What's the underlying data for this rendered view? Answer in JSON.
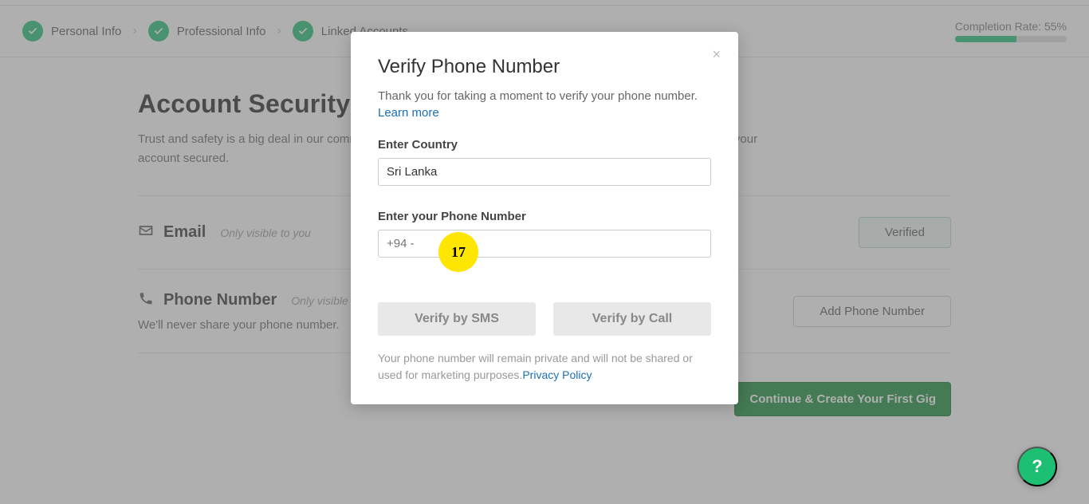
{
  "stepper": {
    "steps": [
      {
        "label": "Personal Info"
      },
      {
        "label": "Professional Info"
      },
      {
        "label": "Linked Accounts"
      }
    ],
    "completion_label": "Completion Rate: 55%",
    "completion_percent": 55
  },
  "page": {
    "title": "Account Security",
    "subtitle": "Trust and safety is a big deal in our community. Please verify your email and phone number so that we can keep your account secured."
  },
  "email_section": {
    "title": "Email",
    "visibility": "Only visible to you",
    "status": "Verified"
  },
  "phone_section": {
    "title": "Phone Number",
    "visibility": "Only visible to you",
    "note": "We'll never share your phone number.",
    "action": "Add Phone Number"
  },
  "continue_button": "Continue & Create Your First Gig",
  "modal": {
    "title": "Verify Phone Number",
    "desc": "Thank you for taking a moment to verify your phone number.",
    "learn_more": "Learn more",
    "country_label": "Enter Country",
    "country_value": "Sri Lanka",
    "phone_label": "Enter your Phone Number",
    "phone_placeholder": "+94 -",
    "verify_sms": "Verify by SMS",
    "verify_call": "Verify by Call",
    "privacy_note": "Your phone number will remain private and will not be shared or used for marketing purposes.",
    "privacy_link": "Privacy Policy"
  },
  "instruction_badge": "17",
  "help_button": "?"
}
